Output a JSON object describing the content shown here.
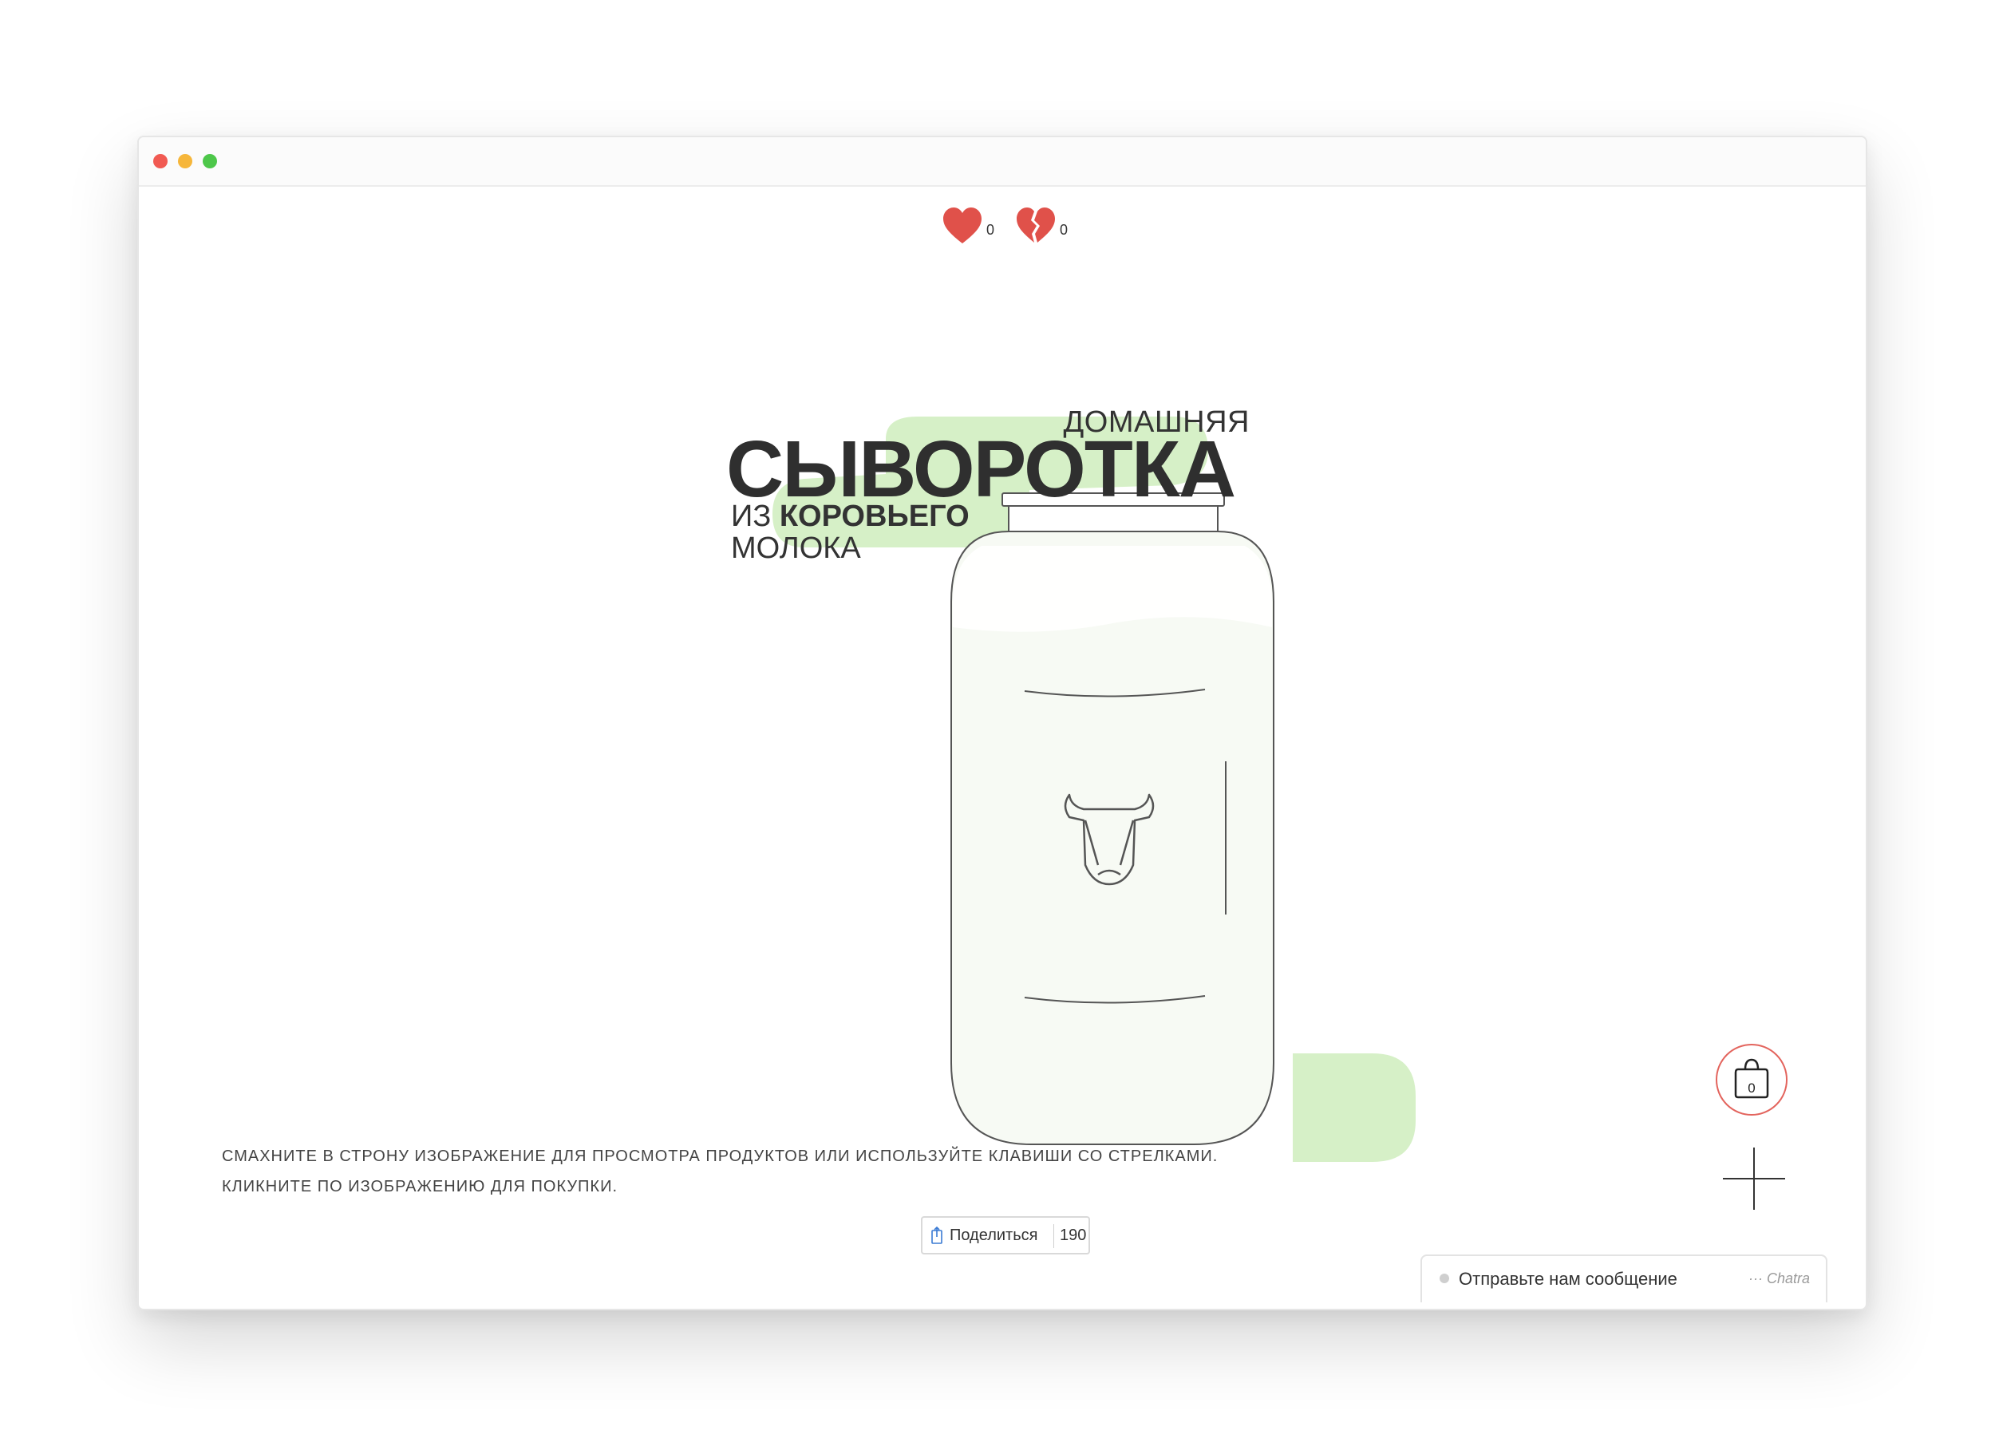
{
  "window": {
    "controls": [
      "close",
      "minimize",
      "maximize"
    ]
  },
  "reactions": {
    "like": {
      "icon": "heart-icon",
      "count": "0"
    },
    "dislike": {
      "icon": "broken-heart-icon",
      "count": "0"
    },
    "color": "#e0514a"
  },
  "product": {
    "title_top": "ДОМАШНЯЯ",
    "title_main": "СЫВОРОТКА",
    "title_from": "ИЗ",
    "title_bold": "КОРОВЬЕГО",
    "title_bottom": "МОЛОКА",
    "accent_color": "#d6f0c7",
    "image_icon": "jar-with-bull-icon"
  },
  "instructions": {
    "line1": "Смахните в строну изображение для просмотра продуктов или используйте клавиши со стрелками.",
    "line2": "Кликните по изображению для покупки."
  },
  "share": {
    "label": "Поделиться",
    "count": "190",
    "icon": "share-icon"
  },
  "cart": {
    "count": "0",
    "icon": "shopping-bag-icon",
    "border_color": "#e3645d"
  },
  "plus": {
    "icon": "plus-icon"
  },
  "chat": {
    "label": "Отправьте нам сообщение",
    "brand": "··· Chatra"
  }
}
